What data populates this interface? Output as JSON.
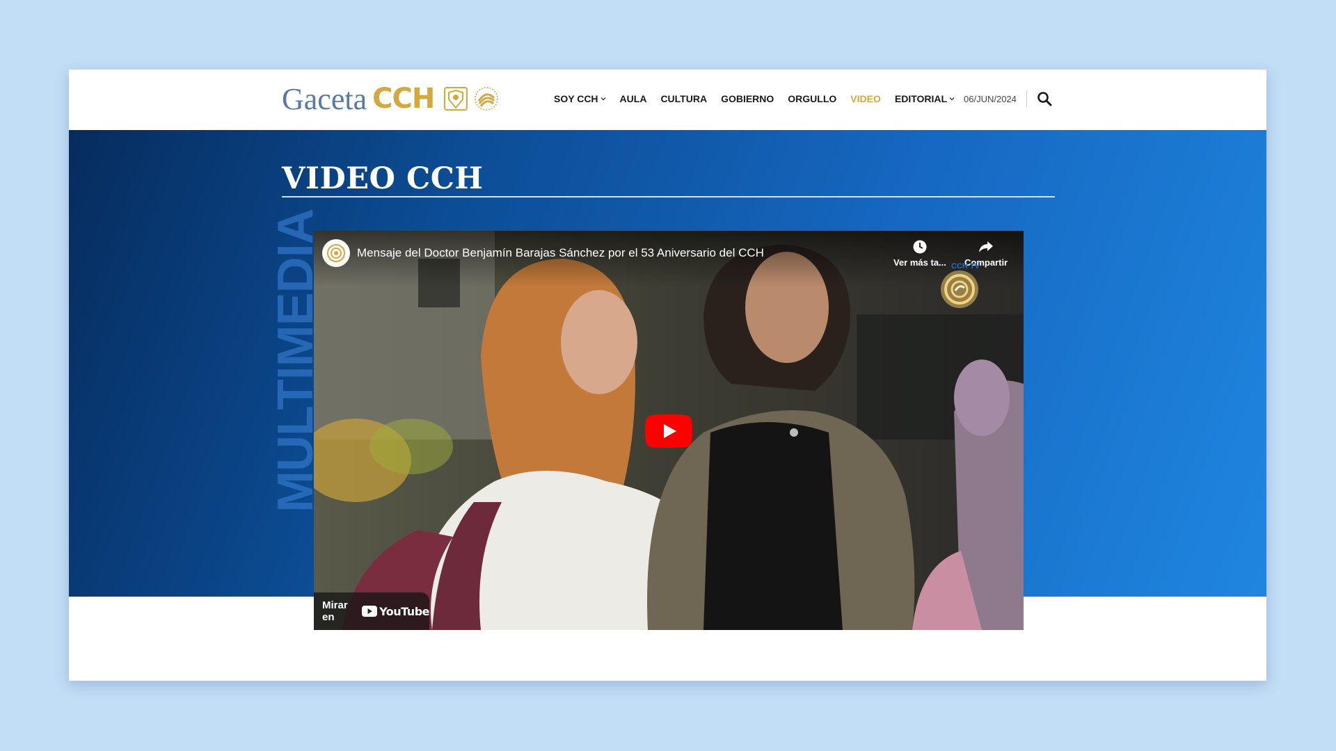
{
  "logo": {
    "word": "Gaceta",
    "brand": "CCH"
  },
  "nav": {
    "items": [
      {
        "label": "SOY CCH",
        "has_dropdown": true,
        "active": false
      },
      {
        "label": "AULA",
        "has_dropdown": false,
        "active": false
      },
      {
        "label": "CULTURA",
        "has_dropdown": false,
        "active": false
      },
      {
        "label": "GOBIERNO",
        "has_dropdown": false,
        "active": false
      },
      {
        "label": "ORGULLO",
        "has_dropdown": false,
        "active": false
      },
      {
        "label": "VIDEO",
        "has_dropdown": false,
        "active": true
      },
      {
        "label": "EDITORIAL",
        "has_dropdown": true,
        "active": false
      }
    ],
    "date": "06/JUN/2024",
    "search_icon": "search-icon"
  },
  "page": {
    "title": "VIDEO CCH",
    "section_label": "MULTIMEDIA"
  },
  "video": {
    "title": "Mensaje del Doctor Benjamín Barajas Sánchez por el 53 Aniversario del CCH",
    "watch_later": "Ver más ta...",
    "share": "Compartir",
    "watch_on": "Mirar en",
    "platform": "YouTube",
    "watermark_text": "CCH TV"
  },
  "colors": {
    "accent_gold": "#d4a83e",
    "banner_dark": "#062c5e",
    "banner_light": "#1f86e0",
    "youtube_red": "#ff0000"
  }
}
